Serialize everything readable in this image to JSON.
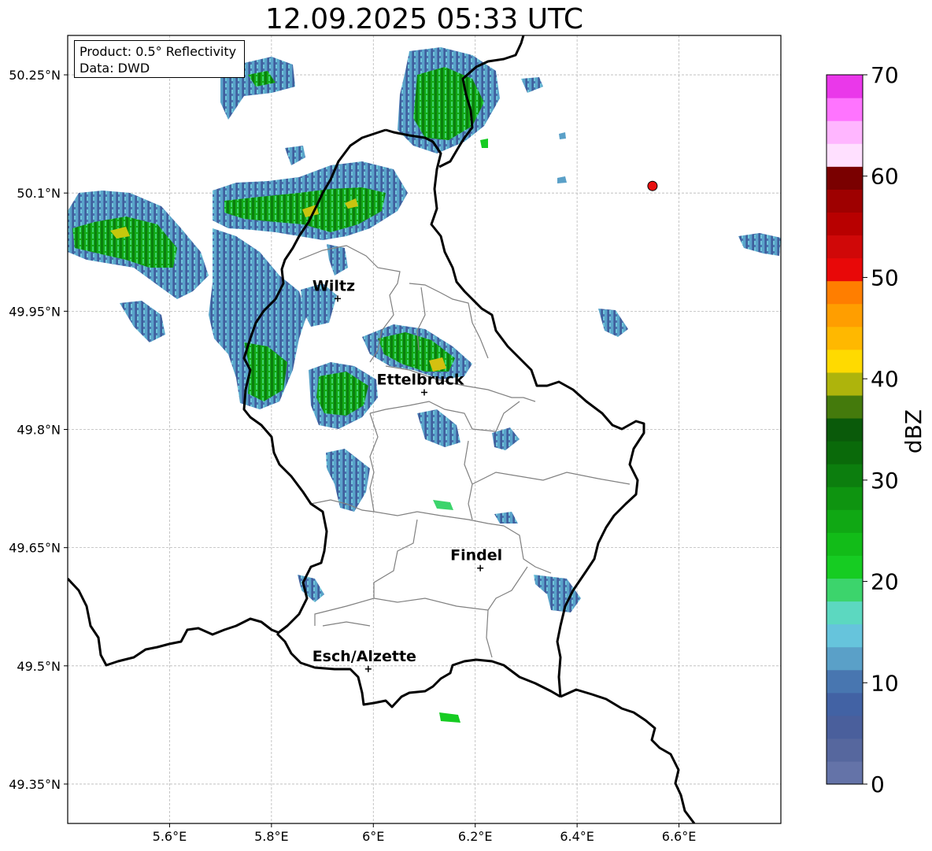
{
  "title": "12.09.2025 05:33 UTC",
  "info": {
    "product": "Product: 0.5° Reflectivity",
    "data": "Data: DWD"
  },
  "map": {
    "lon_range": [
      5.4,
      6.8
    ],
    "lat_range": [
      49.3,
      50.3
    ],
    "lon_ticks": [
      "5.6°E",
      "5.8°E",
      "6°E",
      "6.2°E",
      "6.4°E",
      "6.6°E"
    ],
    "lat_ticks": [
      "50.25°N",
      "50.1°N",
      "49.95°N",
      "49.8°N",
      "49.65°N",
      "49.5°N",
      "49.35°N"
    ],
    "grid": true,
    "cities": [
      {
        "name": "Wiltz",
        "lon": 5.93,
        "lat": 49.966
      },
      {
        "name": "Ettelbruck",
        "lon": 6.1,
        "lat": 49.847
      },
      {
        "name": "Findel",
        "lon": 6.21,
        "lat": 49.624
      },
      {
        "name": "Esch/Alzette",
        "lon": 5.99,
        "lat": 49.496
      }
    ],
    "radar_site": {
      "lon": 6.548,
      "lat": 50.109,
      "color": "#e81010"
    }
  },
  "colorbar": {
    "label": "dBZ",
    "min": 0,
    "max": 70,
    "ticks": [
      "0",
      "10",
      "20",
      "30",
      "40",
      "50",
      "60",
      "70"
    ],
    "colors": [
      "#6473a8",
      "#56679e",
      "#4a5f9c",
      "#4262a4",
      "#4876b0",
      "#5aa0c8",
      "#66c4dc",
      "#5cd8c0",
      "#3cd46c",
      "#16cc22",
      "#12bc18",
      "#10a814",
      "#0e9410",
      "#0c7e0e",
      "#0a6a0a",
      "#0a5a0a",
      "#447a0c",
      "#aeb40c",
      "#ffda00",
      "#ffb800",
      "#ff9e00",
      "#ff7e00",
      "#e80808",
      "#d00808",
      "#b80000",
      "#9e0000",
      "#7a0000",
      "#ffe0ff",
      "#ffb6ff",
      "#ff74ff",
      "#ea38ea"
    ]
  }
}
